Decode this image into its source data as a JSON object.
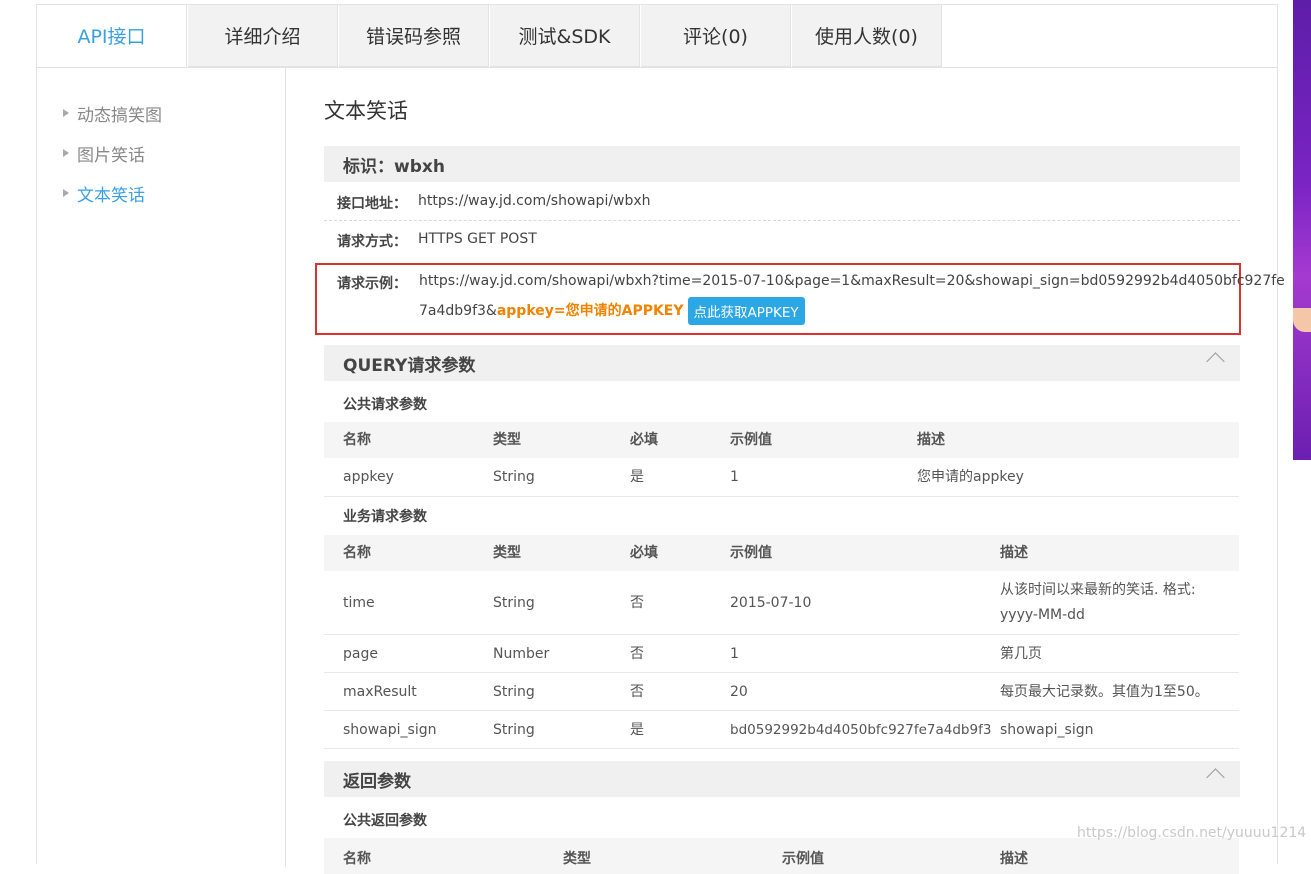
{
  "tabs": [
    "API接口",
    "详细介绍",
    "错误码参照",
    "测试&SDK",
    "评论(0)",
    "使用人数(0)"
  ],
  "active_tab_index": 0,
  "sidebar": {
    "items": [
      "动态搞笑图",
      "图片笑话",
      "文本笑话"
    ],
    "active_index": 2
  },
  "main": {
    "title": "文本笑话",
    "identifier": "标识：wbxh",
    "endpoint": {
      "label": "接口地址：",
      "value": "https://way.jd.com/showapi/wbxh"
    },
    "method": {
      "label": "请求方式：",
      "value": "HTTPS GET POST"
    },
    "example": {
      "label": "请求示例：",
      "line1": "https://way.jd.com/showapi/wbxh?time=2015-07-10&page=1&maxResult=20&showapi_sign=bd0592992b4d4050bfc927fe",
      "line2_prefix": "7a4db9f3&",
      "line2_key": "appkey=您申请的APPKEY",
      "button": "点此获取APPKEY"
    },
    "query_section": {
      "title": "QUERY请求参数",
      "public_title": "公共请求参数",
      "public_headers": [
        "名称",
        "类型",
        "必填",
        "示例值",
        "描述"
      ],
      "public_rows": [
        [
          "appkey",
          "String",
          "是",
          "1",
          "您申请的appkey"
        ]
      ],
      "business_title": "业务请求参数",
      "business_headers": [
        "名称",
        "类型",
        "必填",
        "示例值",
        "描述"
      ],
      "business_rows": [
        [
          "time",
          "String",
          "否",
          "2015-07-10",
          "从该时间以来最新的笑话. 格式:",
          "yyyy-MM-dd"
        ],
        [
          "page",
          "Number",
          "否",
          "1",
          "第几页"
        ],
        [
          "maxResult",
          "String",
          "否",
          "20",
          "每页最大记录数。其值为1至50。"
        ],
        [
          "showapi_sign",
          "String",
          "是",
          "bd0592992b4d4050bfc927fe7a4db9f3",
          "showapi_sign"
        ]
      ]
    },
    "return_section": {
      "title": "返回参数",
      "public_title": "公共返回参数",
      "headers": [
        "名称",
        "类型",
        "示例值",
        "描述"
      ]
    }
  },
  "watermark": "https://blog.csdn.net/yuuuu1214",
  "colors": {
    "accent": "#3aa0e4",
    "highlight_border": "#d9322f",
    "appkey_text": "#f08300",
    "button_bg": "#2aa7e4"
  }
}
